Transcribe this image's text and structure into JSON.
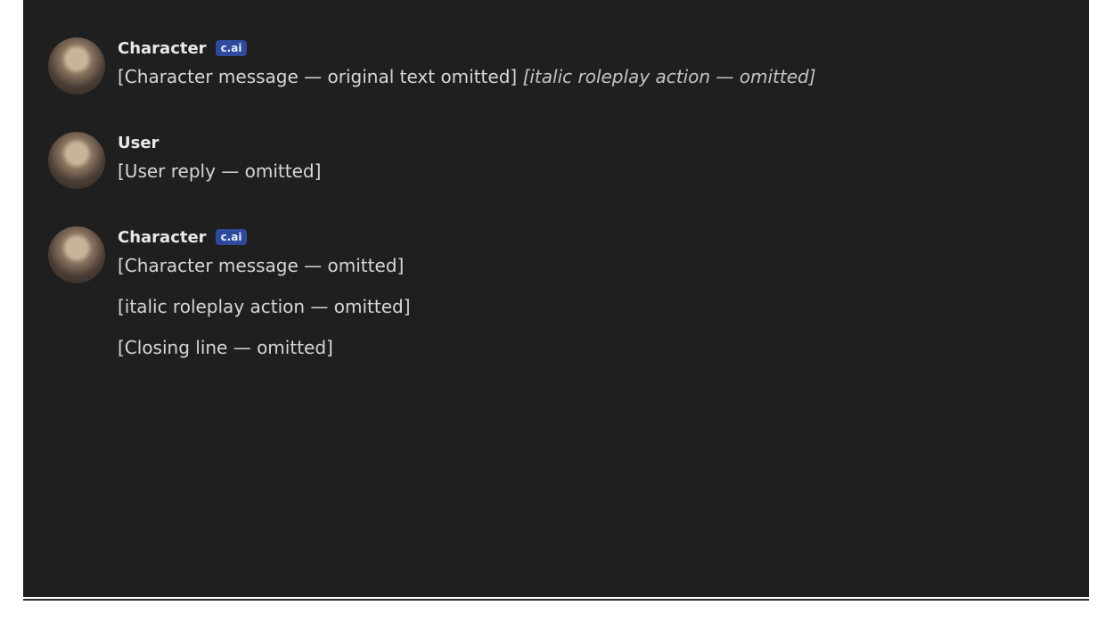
{
  "messages": [
    {
      "author": "Character",
      "badge": "c.ai",
      "text": "[Character message — original text omitted]",
      "action": "[italic roleplay action — omitted]"
    },
    {
      "author": "User",
      "text": "[User reply — omitted]"
    },
    {
      "author": "Character",
      "badge": "c.ai",
      "text": "[Character message — omitted]",
      "action": "[italic roleplay action — omitted]",
      "closing": "[Closing line — omitted]"
    }
  ]
}
